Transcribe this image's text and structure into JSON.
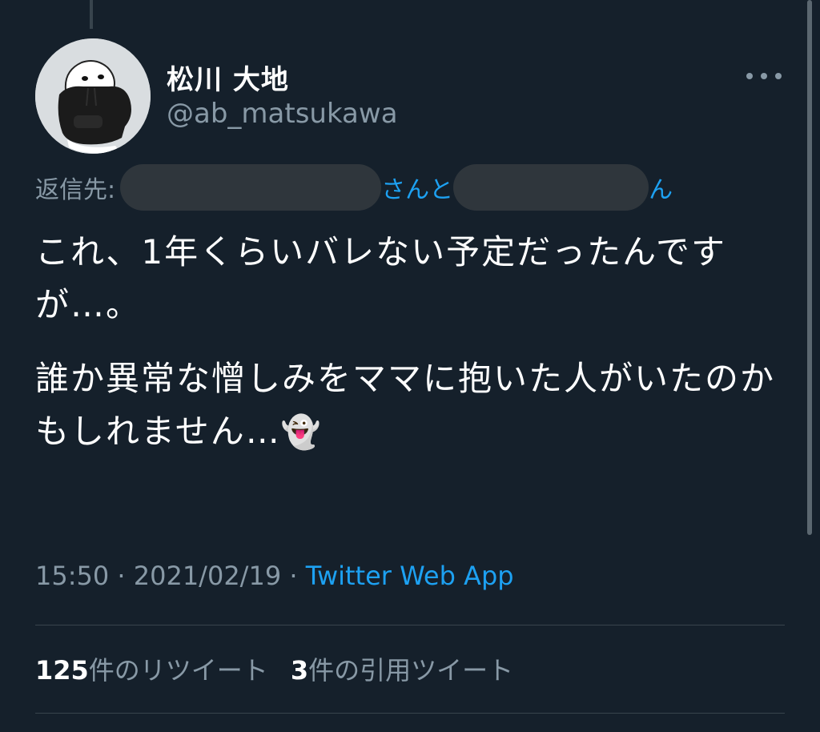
{
  "user": {
    "display_name": "松川 大地",
    "handle": "@ab_matsukawa"
  },
  "reply": {
    "label": "返信先:",
    "mid_text": "さんと",
    "end_text": "ん"
  },
  "tweet": {
    "paragraph1": "これ、1年くらいバレない予定だったんですが…。",
    "paragraph2": "誰か異常な憎しみをママに抱いた人がいたのかもしれません…",
    "emoji": "👻"
  },
  "meta": {
    "time": "15:50",
    "separator": " · ",
    "date": "2021/02/19",
    "source": "Twitter Web App"
  },
  "stats": {
    "retweets_count": "125",
    "retweets_label": "件のリツイート",
    "quotes_count": "3",
    "quotes_label": "件の引用ツイート"
  },
  "colors": {
    "background": "#15202b",
    "accent": "#1da1f2",
    "secondary_text": "#8899a6"
  }
}
